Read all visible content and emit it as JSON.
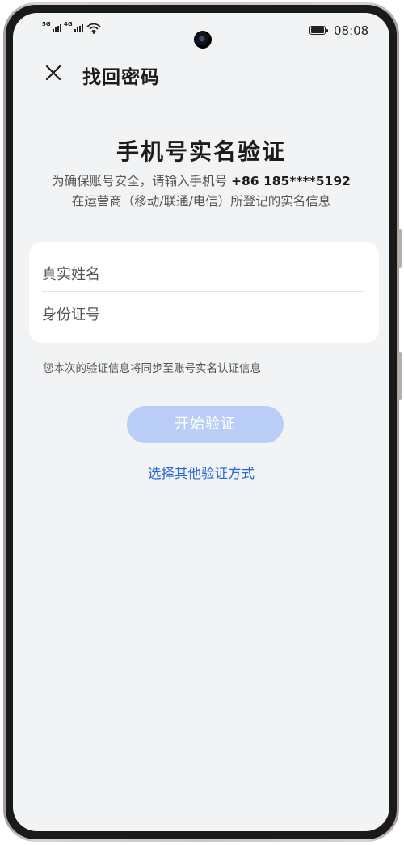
{
  "status_bar": {
    "sim1_label": "5G",
    "sim2_label": "4G",
    "time": "08:08"
  },
  "header": {
    "title": "找回密码"
  },
  "main": {
    "title": "手机号实名验证",
    "description_line1_prefix": "为确保账号安全，请输入手机号",
    "phone_number": "+86 185****5192",
    "description_line2": "在运营商（移动/联通/电信）所登记的实名信息",
    "name_placeholder": "真实姓名",
    "id_placeholder": "身份证号",
    "sync_notice": "您本次的验证信息将同步至账号实名认证信息",
    "start_button_label": "开始验证",
    "other_method_link": "选择其他验证方式"
  },
  "colors": {
    "screen_bg": "#f1f3f5",
    "button_disabled": "#b9cdf7",
    "link": "#2468d8"
  }
}
